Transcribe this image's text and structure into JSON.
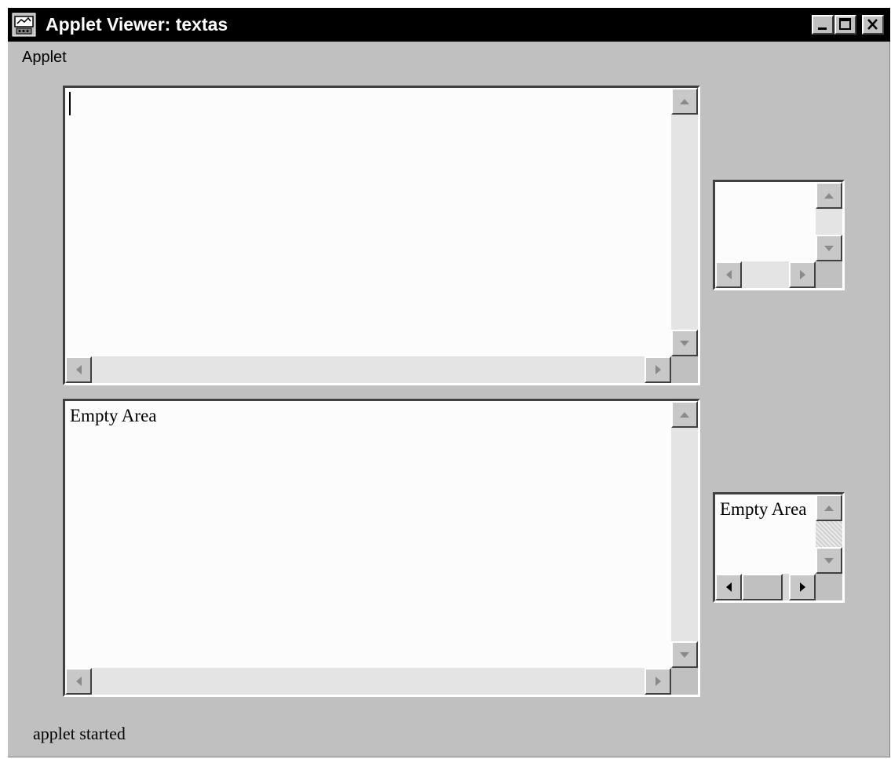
{
  "window": {
    "title": "Applet Viewer: textas",
    "controls": {
      "minimize": "minimize-icon",
      "maximize": "maximize-icon",
      "close": "close-icon"
    }
  },
  "menubar": {
    "items": [
      {
        "label": "Applet"
      }
    ]
  },
  "textareas": [
    {
      "name": "large-empty-textarea",
      "text": ""
    },
    {
      "name": "small-empty-textarea",
      "text": ""
    },
    {
      "name": "large-text-textarea",
      "text": "Empty Area"
    },
    {
      "name": "small-text-textarea",
      "text": "Empty Area"
    }
  ],
  "status": {
    "text": "applet started"
  }
}
